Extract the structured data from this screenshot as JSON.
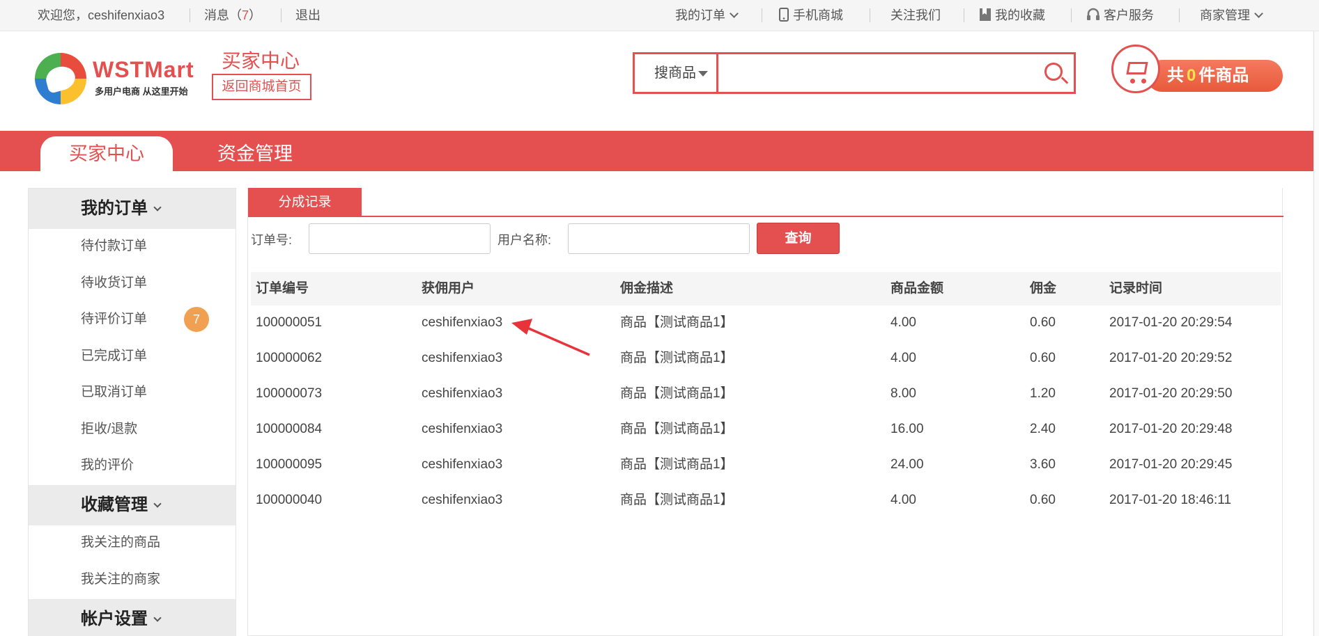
{
  "topbar": {
    "welcome": "欢迎您，ceshifenxiao3",
    "messages_label": "消息（",
    "messages_count": "7",
    "messages_close": "）",
    "logout": "退出",
    "my_orders": "我的订单",
    "mobile_mall": "手机商城",
    "follow_us": "关注我们",
    "my_favorites": "我的收藏",
    "customer_service": "客户服务",
    "merchant_mgmt": "商家管理"
  },
  "header": {
    "logo_text": "WSTMart",
    "logo_slogan": "多用户电商 从这里开始",
    "center_title": "买家中心",
    "back_home": "返回商城首页",
    "search_type": "搜商品",
    "search_value": "",
    "cart_prefix": "共",
    "cart_count": "0",
    "cart_suffix": "件商品"
  },
  "nav": {
    "tabs": [
      {
        "label": "买家中心"
      },
      {
        "label": "资金管理"
      }
    ]
  },
  "sidebar": {
    "sections": [
      {
        "title": "我的订单",
        "items": [
          "待付款订单",
          "待收货订单",
          "待评价订单",
          "已完成订单",
          "已取消订单",
          "拒收/退款",
          "我的评价"
        ]
      },
      {
        "title": "收藏管理",
        "items": [
          "我关注的商品",
          "我关注的商家"
        ]
      },
      {
        "title": "帐户设置"
      }
    ],
    "badge_pending_review": "7"
  },
  "main": {
    "tab": "分成记录",
    "filter": {
      "order_no_label": "订单号:",
      "order_no_value": "",
      "username_label": "用户名称:",
      "username_value": "",
      "query_button": "查询"
    },
    "table": {
      "columns": [
        "订单编号",
        "获佣用户",
        "佣金描述",
        "商品金额",
        "佣金",
        "记录时间"
      ],
      "rows": [
        [
          "100000051",
          "ceshifenxiao3",
          "商品【测试商品1】",
          "4.00",
          "0.60",
          "2017-01-20 20:29:54"
        ],
        [
          "100000062",
          "ceshifenxiao3",
          "商品【测试商品1】",
          "4.00",
          "0.60",
          "2017-01-20 20:29:52"
        ],
        [
          "100000073",
          "ceshifenxiao3",
          "商品【测试商品1】",
          "8.00",
          "1.20",
          "2017-01-20 20:29:50"
        ],
        [
          "100000084",
          "ceshifenxiao3",
          "商品【测试商品1】",
          "16.00",
          "2.40",
          "2017-01-20 20:29:48"
        ],
        [
          "100000095",
          "ceshifenxiao3",
          "商品【测试商品1】",
          "24.00",
          "3.60",
          "2017-01-20 20:29:45"
        ],
        [
          "100000040",
          "ceshifenxiao3",
          "商品【测试商品1】",
          "4.00",
          "0.60",
          "2017-01-20 18:46:11"
        ]
      ]
    }
  },
  "colors": {
    "brand_red": "#e45050",
    "badge_orange": "#f0a050",
    "cart_count_yellow": "#ffe14a"
  }
}
